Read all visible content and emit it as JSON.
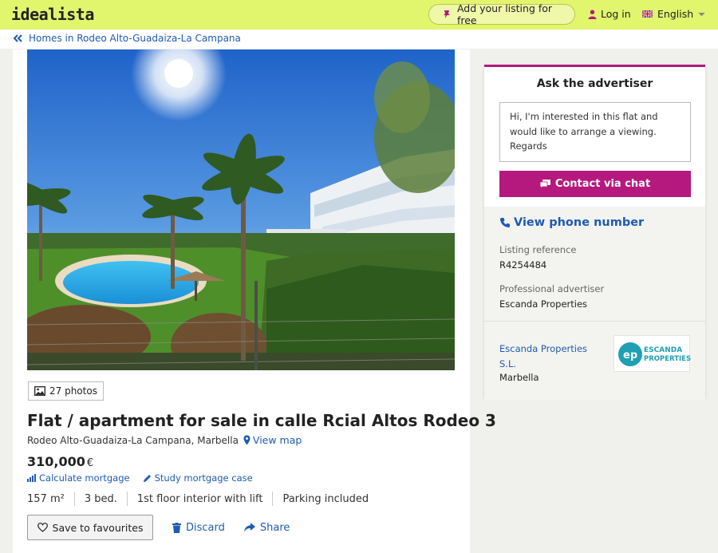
{
  "header": {
    "logo": "idealista",
    "add_listing": "Add your listing for free",
    "login": "Log in",
    "language": "English"
  },
  "breadcrumb": {
    "label": "Homes in Rodeo Alto-Guadaiza-La Campana"
  },
  "listing": {
    "photos_count": "27 photos",
    "title": "Flat / apartment for sale in calle Rcial Altos Rodeo 3",
    "location": "Rodeo Alto-Guadaiza-La Campana, Marbella",
    "view_map": "View map",
    "price": "310,000",
    "currency": "€",
    "calc_mortgage": "Calculate mortgage",
    "study_mortgage": "Study mortgage case",
    "features": [
      "157 m²",
      "3 bed.",
      "1st floor interior with lift",
      "Parking included"
    ],
    "save_fav": "Save to favourites",
    "discard": "Discard",
    "share": "Share"
  },
  "contact": {
    "title": "Ask the advertiser",
    "message": "Hi, I'm interested in this flat and would like to arrange a viewing. Regards",
    "chat_button": "Contact via chat",
    "phone_link": "View phone number",
    "ref_label": "Listing reference",
    "ref_value": "R4254484",
    "adv_label": "Professional advertiser",
    "adv_value": "Escanda Properties",
    "agency_name": "Escanda Properties S.L.",
    "agency_city": "Marbella",
    "agency_logo_text": "ESCANDA PROPERTIES",
    "agency_logo_mark": "ep"
  },
  "colors": {
    "brand_bar": "#e1f56d",
    "accent_magenta": "#b5197d",
    "link_blue": "#1f5bb2"
  }
}
